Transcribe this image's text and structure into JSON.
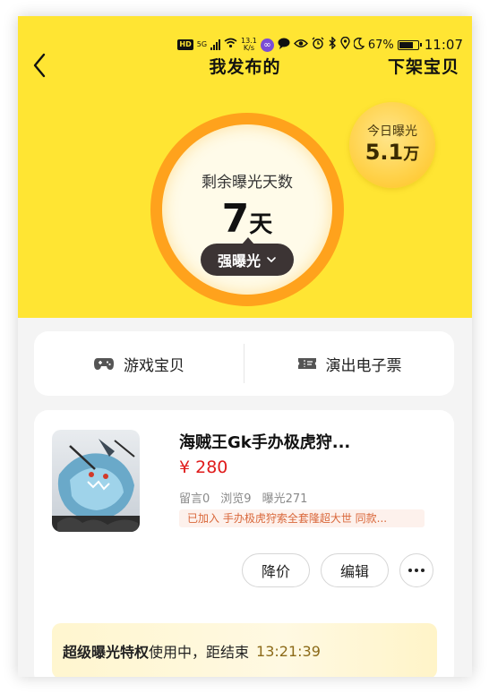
{
  "status_bar": {
    "hd": "HD",
    "net": "5G",
    "speed_value": "13.1",
    "speed_unit": "K/s",
    "battery": "67%",
    "time": "11:07"
  },
  "header": {
    "title": "我发布的",
    "offshelf_label": "下架宝贝"
  },
  "exposure": {
    "remaining_label": "剩余曝光天数",
    "remaining_value": "7",
    "remaining_unit": "天",
    "mode_label": "强曝光",
    "today_label": "今日曝光",
    "today_value": "5.1",
    "today_unit": "万"
  },
  "categories": [
    {
      "label": "游戏宝贝",
      "icon": "gamepad-icon"
    },
    {
      "label": "演出电子票",
      "icon": "ticket-icon"
    }
  ],
  "item": {
    "title": "海贼王Gk手办极虎狩...",
    "price": "¥ 280",
    "stats": [
      "留言0",
      "浏览9",
      "曝光271"
    ],
    "tag": "已加入 手办极虎狩索全套隆超大世 同款...",
    "actions": {
      "reduce_price": "降价",
      "edit": "编辑"
    }
  },
  "privilege": {
    "name": "超级曝光特权",
    "status": "使用中，距结束",
    "countdown": "13:21:39"
  },
  "colors": {
    "brand_yellow": "#ffe533",
    "ring_orange": "#ffa21c",
    "price_red": "#e01b1b",
    "tag_orange": "#d9673a"
  }
}
